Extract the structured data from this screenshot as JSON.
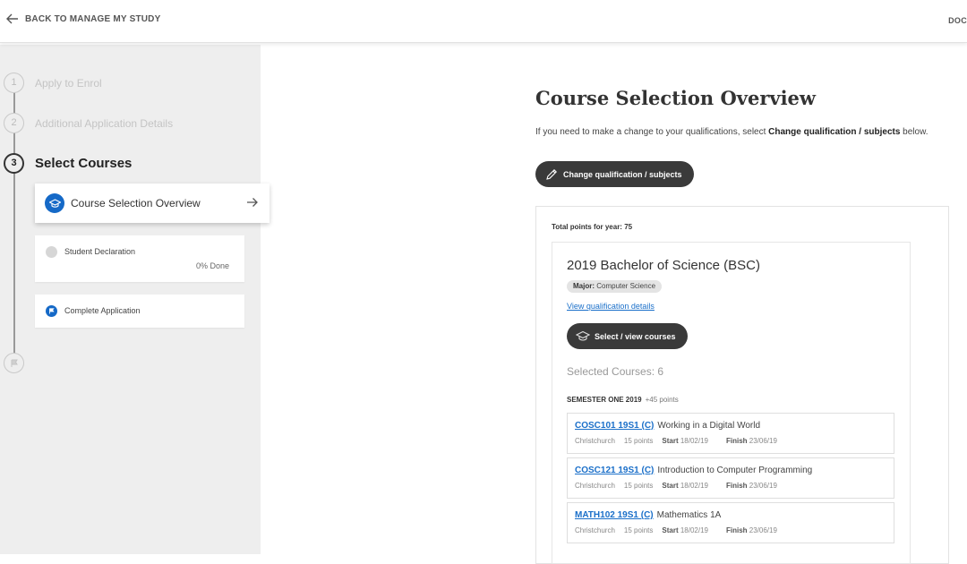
{
  "topbar": {
    "back_label": "BACK TO MANAGE MY STUDY",
    "right_label": "DOC"
  },
  "steps": [
    {
      "number": "1",
      "label": "Apply to Enrol"
    },
    {
      "number": "2",
      "label": "Additional Application Details"
    },
    {
      "number": "3",
      "label": "Select Courses"
    }
  ],
  "substeps": {
    "overview": {
      "label": "Course Selection Overview"
    },
    "declaration": {
      "label": "Student Declaration",
      "progress_label": "0% Done"
    },
    "complete": {
      "label": "Complete Application"
    }
  },
  "main": {
    "title": "Course Selection Overview",
    "intro_text": "If you need to make a change to your qualifications, select ",
    "intro_bold": "Change qualification / subjects",
    "intro_end": " below.",
    "change_button": "Change qualification / subjects",
    "total_points": "Total points for year: 75"
  },
  "qualification": {
    "title": "2019 Bachelor of Science (BSC)",
    "major_prefix": "Major:",
    "major_value": " Computer Science",
    "view_link": "View qualification details",
    "select_button": "Select / view courses",
    "selected_count": "Selected Courses: 6"
  },
  "semester": {
    "name": "SEMESTER ONE 2019",
    "points": "+45 points"
  },
  "courses": [
    {
      "code": "COSC101 19S1 (C)",
      "name": "Working in a Digital World",
      "location": "Christchurch",
      "points": "15 points",
      "start_label": "Start",
      "start": "18/02/19",
      "finish_label": "Finish",
      "finish": "23/06/19"
    },
    {
      "code": "COSC121 19S1 (C)",
      "name": "Introduction to Computer Programming",
      "location": "Christchurch",
      "points": "15 points",
      "start_label": "Start",
      "start": "18/02/19",
      "finish_label": "Finish",
      "finish": "23/06/19"
    },
    {
      "code": "MATH102 19S1 (C)",
      "name": "Mathematics 1A",
      "location": "Christchurch",
      "points": "15 points",
      "start_label": "Start",
      "start": "18/02/19",
      "finish_label": "Finish",
      "finish": "23/06/19"
    }
  ],
  "colors": {
    "accent": "#1569c7",
    "dark_button": "#3a3a3a",
    "sidebar_bg": "#eeeeee",
    "link": "#1a6fc9"
  },
  "icons": {
    "back": "arrow-left-icon",
    "overview_badge": "graduation-cap-icon",
    "overview_arrow": "arrow-right-icon",
    "complete_badge": "flag-icon",
    "rail_end": "flag-icon",
    "change_button": "pencil-icon",
    "select_button": "graduation-cap-icon"
  }
}
